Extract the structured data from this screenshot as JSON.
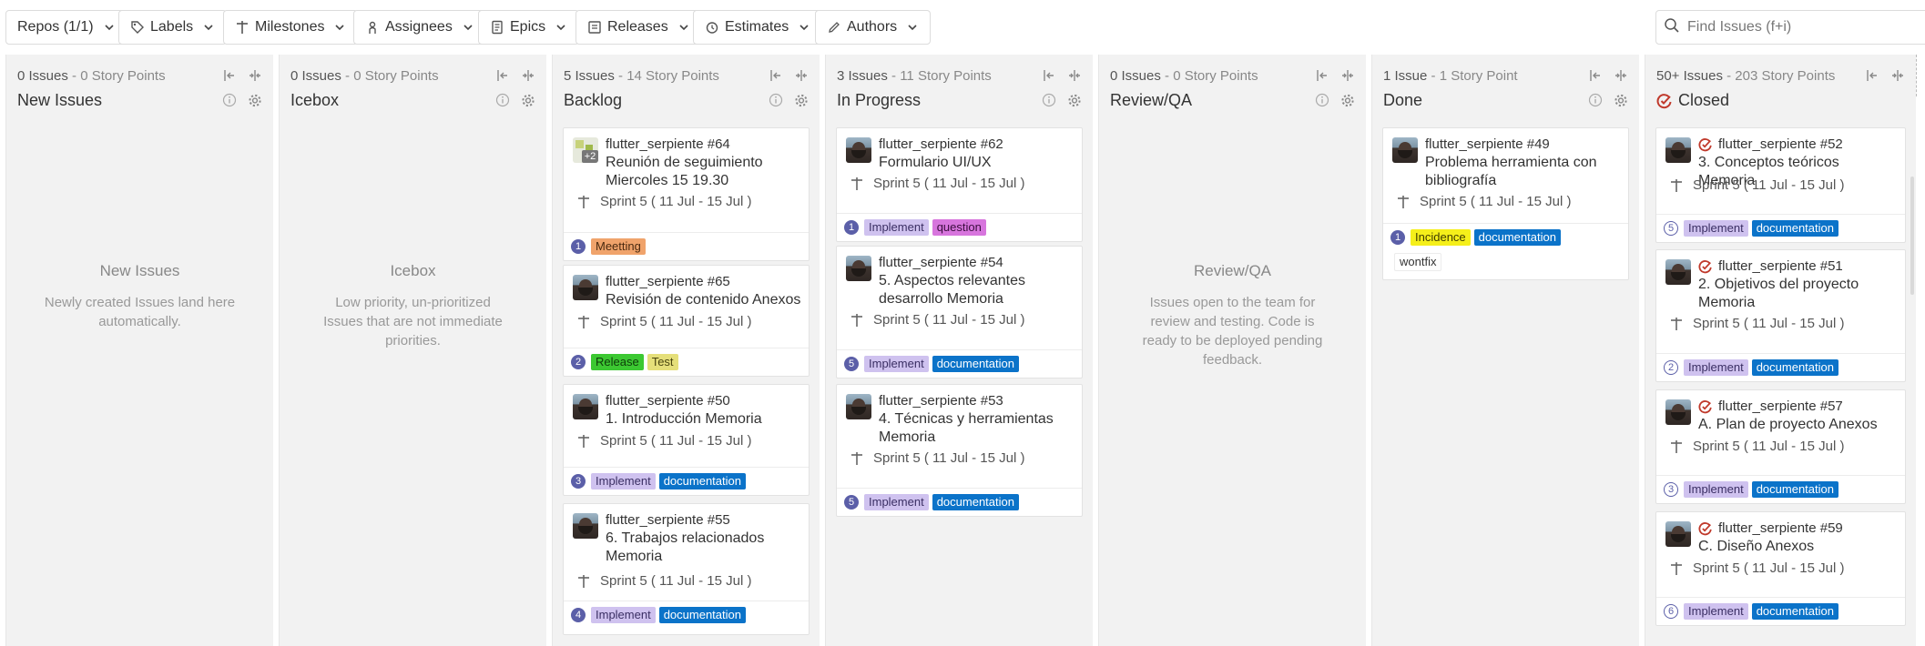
{
  "toolbar": {
    "buttons": [
      {
        "key": "repos",
        "label": "Repos (1/1)",
        "icon": "repo-icon"
      },
      {
        "key": "labels",
        "label": "Labels",
        "icon": "tag-icon"
      },
      {
        "key": "milestones",
        "label": "Milestones",
        "icon": "milestone-icon"
      },
      {
        "key": "assignees",
        "label": "Assignees",
        "icon": "person-icon"
      },
      {
        "key": "epics",
        "label": "Epics",
        "icon": "epic-icon"
      },
      {
        "key": "releases",
        "label": "Releases",
        "icon": "release-icon"
      },
      {
        "key": "estimates",
        "label": "Estimates",
        "icon": "estimate-icon"
      },
      {
        "key": "authors",
        "label": "Authors",
        "icon": "pencil-icon"
      }
    ],
    "search_placeholder": "Find Issues (f+i)"
  },
  "columns": [
    {
      "stats_count": "0 Issues",
      "stats_points": " - 0 Story Points",
      "title": "New Issues",
      "empty_title": "New Issues",
      "empty_desc": "Newly created Issues land here automatically."
    },
    {
      "stats_count": "0 Issues",
      "stats_points": " - 0 Story Points",
      "title": "Icebox",
      "empty_title": "Icebox",
      "empty_desc": "Low priority, un-prioritized Issues that are not immediate priorities."
    },
    {
      "stats_count": "5 Issues",
      "stats_points": " - 14 Story Points",
      "title": "Backlog",
      "cards": [
        {
          "repo": "flutter_serpiente #64",
          "title": "Reunión de seguimiento Miercoles 15 19.30",
          "milestone": "Sprint 5 ( 11 Jul - 15 Jul )",
          "estimate": "1",
          "avatar_extra": "+2",
          "labels": [
            {
              "text": "Meetting",
              "bg": "#f0a36b",
              "fg": "#4a2a10"
            }
          ]
        },
        {
          "repo": "flutter_serpiente #65",
          "title": "Revisión de contenido Anexos",
          "milestone": "Sprint 5 ( 11 Jul - 15 Jul )",
          "estimate": "2",
          "labels": [
            {
              "text": "Release",
              "bg": "#3cc832",
              "fg": "#0e3b0a"
            },
            {
              "text": "Test",
              "bg": "#e5df7a",
              "fg": "#4a4610"
            }
          ]
        },
        {
          "repo": "flutter_serpiente #50",
          "title": "1. Introducción Memoria",
          "milestone": "Sprint 5 ( 11 Jul - 15 Jul )",
          "estimate": "3",
          "labels": [
            {
              "text": "Implement",
              "bg": "#cfc2ef",
              "fg": "#3a2e63"
            },
            {
              "text": "documentation",
              "bg": "#0b73c9",
              "fg": "#ffffff"
            }
          ]
        },
        {
          "repo": "flutter_serpiente #55",
          "title": "6. Trabajos relacionados Memoria",
          "milestone": "Sprint 5 ( 11 Jul - 15 Jul )",
          "estimate": "4",
          "labels": [
            {
              "text": "Implement",
              "bg": "#cfc2ef",
              "fg": "#3a2e63"
            },
            {
              "text": "documentation",
              "bg": "#0b73c9",
              "fg": "#ffffff"
            }
          ]
        }
      ]
    },
    {
      "stats_count": "3 Issues",
      "stats_points": " - 11 Story Points",
      "title": "In Progress",
      "cards": [
        {
          "repo": "flutter_serpiente #62",
          "title": "Formulario UI/UX",
          "milestone": "Sprint 5 ( 11 Jul - 15 Jul )",
          "estimate": "1",
          "labels": [
            {
              "text": "Implement",
              "bg": "#cfc2ef",
              "fg": "#3a2e63"
            },
            {
              "text": "question",
              "bg": "#d775dd",
              "fg": "#3b0d3f"
            }
          ]
        },
        {
          "repo": "flutter_serpiente #54",
          "title": "5. Aspectos relevantes desarrollo Memoria",
          "milestone": "Sprint 5 ( 11 Jul - 15 Jul )",
          "estimate": "5",
          "labels": [
            {
              "text": "Implement",
              "bg": "#cfc2ef",
              "fg": "#3a2e63"
            },
            {
              "text": "documentation",
              "bg": "#0b73c9",
              "fg": "#ffffff"
            }
          ]
        },
        {
          "repo": "flutter_serpiente #53",
          "title": "4. Técnicas y herramientas Memoria",
          "milestone": "Sprint 5 ( 11 Jul - 15 Jul )",
          "estimate": "5",
          "labels": [
            {
              "text": "Implement",
              "bg": "#cfc2ef",
              "fg": "#3a2e63"
            },
            {
              "text": "documentation",
              "bg": "#0b73c9",
              "fg": "#ffffff"
            }
          ]
        }
      ]
    },
    {
      "stats_count": "0 Issues",
      "stats_points": " - 0 Story Points",
      "title": "Review/QA",
      "empty_title": "Review/QA",
      "empty_desc": "Issues open to the team for review and testing. Code is ready to be deployed pending feedback."
    },
    {
      "stats_count": "1 Issue",
      "stats_points": " - 1 Story Point",
      "title": "Done",
      "cards": [
        {
          "repo": "flutter_serpiente #49",
          "title": "Problema herramienta con bibliografía",
          "milestone": "Sprint 5 ( 11 Jul - 15 Jul )",
          "estimate": "1",
          "labels": [
            {
              "text": "Incidence",
              "bg": "#f5ef1a",
              "fg": "#3f3c00"
            },
            {
              "text": "documentation",
              "bg": "#0b73c9",
              "fg": "#ffffff"
            }
          ],
          "extra_label": "wontfix"
        }
      ]
    },
    {
      "stats_count": "50+ Issues",
      "stats_points": " - 203 Story Points",
      "title": "Closed",
      "cards": [
        {
          "repo": "flutter_serpiente #52",
          "title": "3. Conceptos teóricos Memoria",
          "milestone": "Sprint 5 ( 11 Jul - 15 Jul )",
          "estimate": "5",
          "labels": [
            {
              "text": "Implement",
              "bg": "#cfc2ef",
              "fg": "#3a2e63"
            },
            {
              "text": "documentation",
              "bg": "#0b73c9",
              "fg": "#ffffff"
            }
          ]
        },
        {
          "repo": "flutter_serpiente #51",
          "title": "2. Objetivos del proyecto Memoria",
          "milestone": "Sprint 5 ( 11 Jul - 15 Jul )",
          "estimate": "2",
          "labels": [
            {
              "text": "Implement",
              "bg": "#cfc2ef",
              "fg": "#3a2e63"
            },
            {
              "text": "documentation",
              "bg": "#0b73c9",
              "fg": "#ffffff"
            }
          ]
        },
        {
          "repo": "flutter_serpiente #57",
          "title": "A. Plan de proyecto Anexos",
          "milestone": "Sprint 5 ( 11 Jul - 15 Jul )",
          "estimate": "3",
          "labels": [
            {
              "text": "Implement",
              "bg": "#cfc2ef",
              "fg": "#3a2e63"
            },
            {
              "text": "documentation",
              "bg": "#0b73c9",
              "fg": "#ffffff"
            }
          ]
        },
        {
          "repo": "flutter_serpiente #59",
          "title": "C. Diseño Anexos",
          "milestone": "Sprint 5 ( 11 Jul - 15 Jul )",
          "estimate": "6",
          "labels": [
            {
              "text": "Implement",
              "bg": "#cfc2ef",
              "fg": "#3a2e63"
            },
            {
              "text": "documentation",
              "bg": "#0b73c9",
              "fg": "#ffffff"
            }
          ]
        }
      ]
    }
  ]
}
